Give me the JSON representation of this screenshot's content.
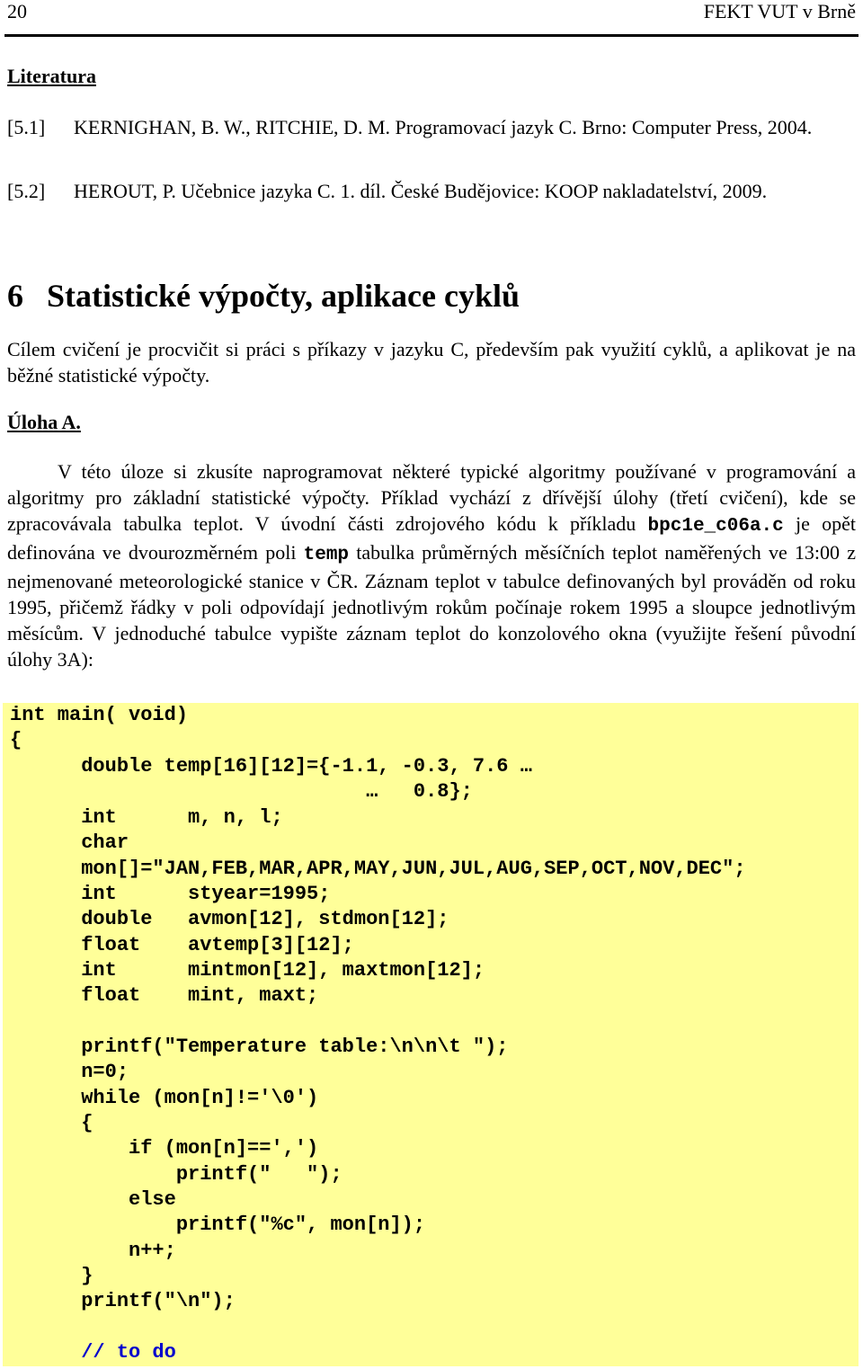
{
  "header": {
    "page_number": "20",
    "institution": "FEKT VUT v Brně"
  },
  "literature": {
    "title": "Literatura",
    "references": [
      {
        "tag": "[5.1]",
        "text": "KERNIGHAN, B. W., RITCHIE, D. M. Programovací jazyk C. Brno: Computer Press, 2004."
      },
      {
        "tag": "[5.2]",
        "text": "HEROUT, P. Učebnice jazyka C. 1. díl. České Budějovice: KOOP nakladatelství, 2009."
      }
    ]
  },
  "chapter": {
    "number": "6",
    "title": "Statistické výpočty, aplikace cyklů",
    "intro": "Cílem cvičení je procvičit si práci s příkazy v jazyku C, především pak využití cyklů, a aplikovat je na běžné statistické výpočty."
  },
  "task": {
    "title": "Úloha A.",
    "paragraph_part1": "V této úloze si zkusíte naprogramovat některé typické algoritmy používané v programování a algoritmy pro základní statistické výpočty. Příklad vychází z dřívější úlohy (třetí cvičení), kde se zpracovávala tabulka teplot. V úvodní části zdrojového kódu k příkladu ",
    "filename": "bpc1e_c06a.c",
    "paragraph_part2": " je opět definována ve dvourozměrném poli ",
    "array_name": "temp",
    "paragraph_part3": " tabulka průměrných měsíčních teplot naměřených ve 13:00 z nejmenované meteorologické stanice v ČR. Záznam teplot v tabulce definovaných byl prováděn od roku 1995, přičemž řádky v poli odpovídají jednotlivým rokům počínaje rokem 1995 a sloupce jednotlivým měsícům. V jednoduché tabulce vypište záznam teplot do konzolového okna (využijte řešení původní úlohy 3A):"
  },
  "code": {
    "background_color": "#ffff99",
    "comment_color": "#0000cc",
    "lines": [
      "int main( void)",
      "{",
      "      double temp[16][12]={-1.1, -0.3, 7.6 …",
      "                              …   0.8};",
      "      int      m, n, l;",
      "      char",
      "      mon[]=\"JAN,FEB,MAR,APR,MAY,JUN,JUL,AUG,SEP,OCT,NOV,DEC\";",
      "      int      styear=1995;",
      "      double   avmon[12], stdmon[12];",
      "      float    avtemp[3][12];",
      "      int      mintmon[12], maxtmon[12];",
      "      float    mint, maxt;",
      "",
      "      printf(\"Temperature table:\\n\\n\\t \");",
      "      n=0;",
      "      while (mon[n]!='\\0')",
      "      {",
      "          if (mon[n]==',')",
      "              printf(\"   \");",
      "          else",
      "              printf(\"%c\", mon[n]);",
      "          n++;",
      "      }",
      "      printf(\"\\n\");",
      "",
      "      // to do"
    ]
  }
}
